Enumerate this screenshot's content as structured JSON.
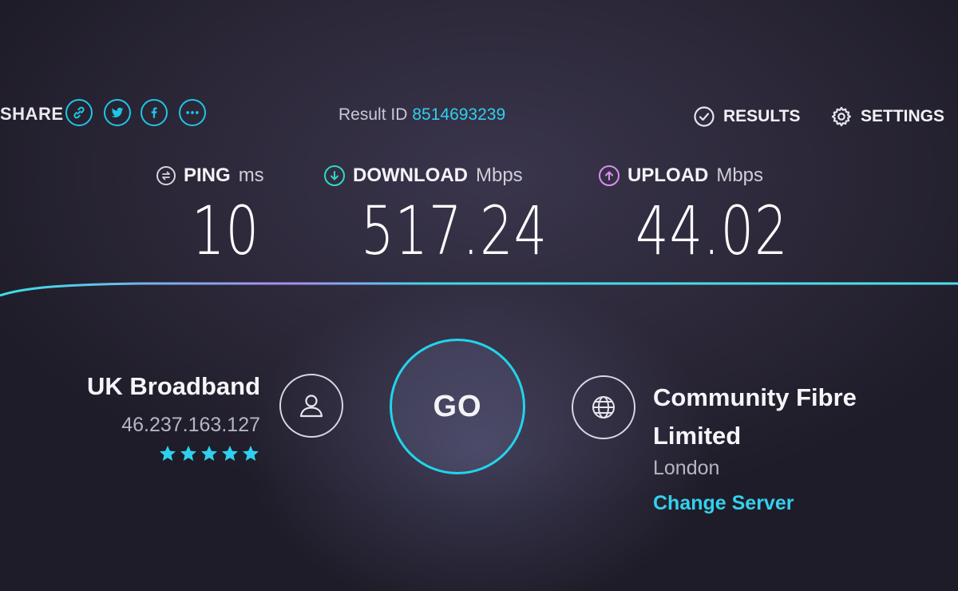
{
  "share": {
    "label": "SHARE",
    "buttons": [
      "link-icon",
      "twitter-icon",
      "facebook-icon",
      "more-icon"
    ]
  },
  "result": {
    "label": "Result ID",
    "id": "8514693239"
  },
  "actions": {
    "results_label": "RESULTS",
    "settings_label": "SETTINGS"
  },
  "metrics": {
    "ping": {
      "name": "PING",
      "unit": "ms",
      "value": "10",
      "icon": "ping-icon"
    },
    "download": {
      "name": "DOWNLOAD",
      "unit": "Mbps",
      "value": "517.24",
      "icon": "download-arrow-icon"
    },
    "upload": {
      "name": "UPLOAD",
      "unit": "Mbps",
      "value": "44.02",
      "icon": "upload-arrow-icon"
    }
  },
  "isp": {
    "name": "UK Broadband",
    "ip": "46.237.163.127",
    "rating_stars": 5
  },
  "go": {
    "label": "GO"
  },
  "server": {
    "name_line1": "Community Fibre",
    "name_line2": "Limited",
    "city": "London",
    "change_label": "Change Server"
  },
  "colors": {
    "accent": "#1fc6e5",
    "download": "#2fd8c4",
    "upload": "#d98ff0",
    "star": "#2fd0ee"
  }
}
